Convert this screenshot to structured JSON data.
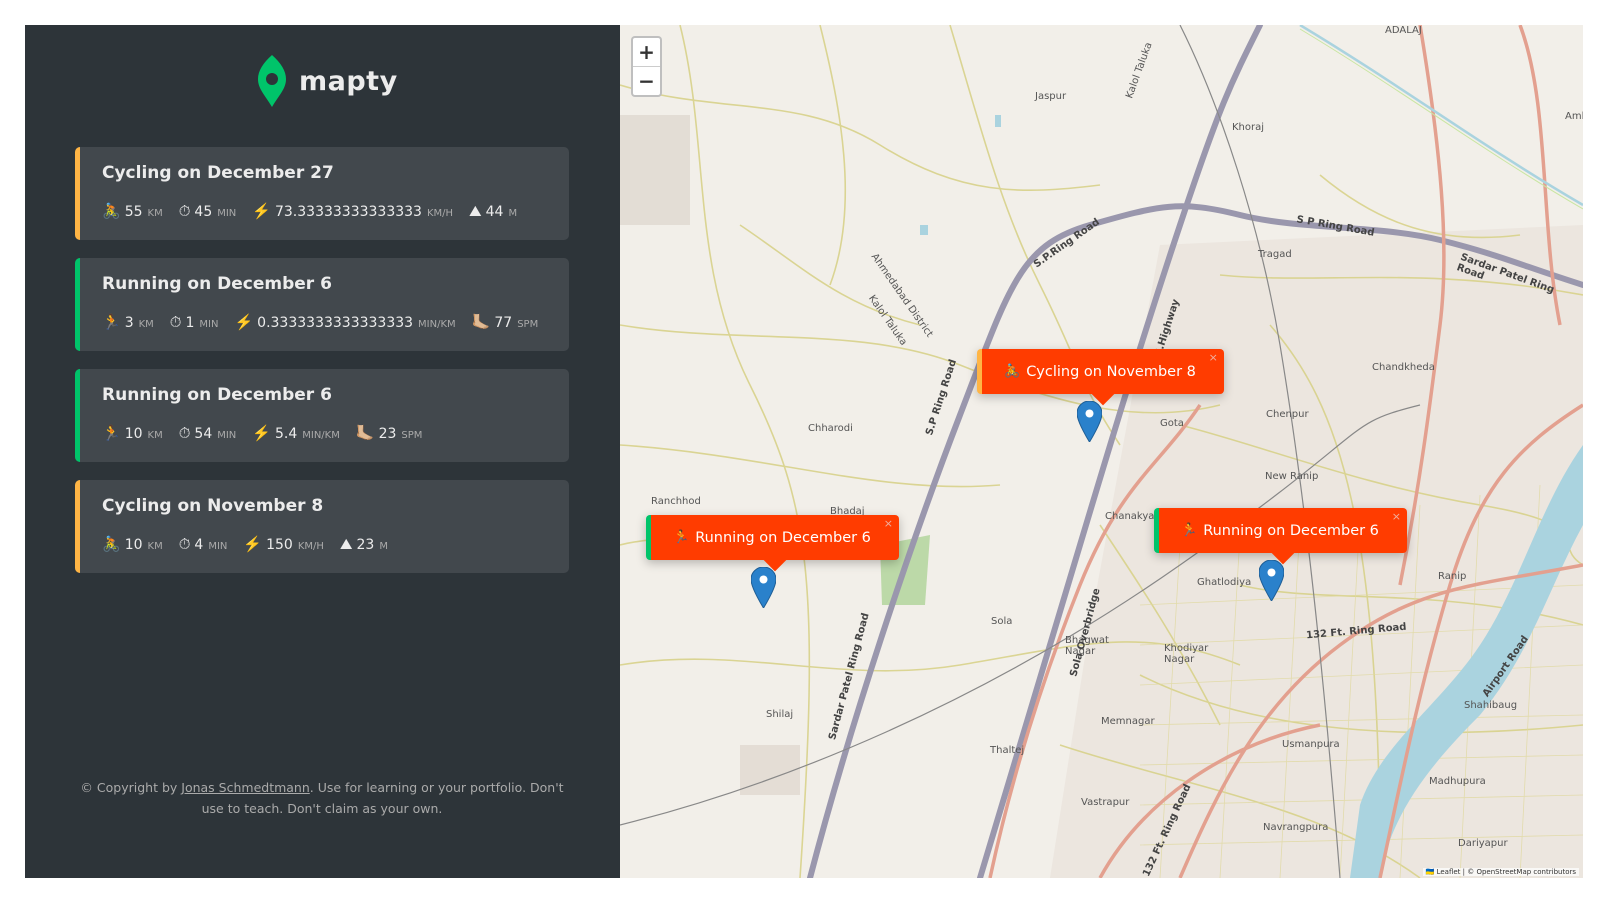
{
  "brand": {
    "name": "mapty"
  },
  "workouts": [
    {
      "type": "cycling",
      "title": "Cycling on December 27",
      "stats": [
        {
          "icon": "🚴",
          "value": "55",
          "unit": "km"
        },
        {
          "icon": "⏱",
          "value": "45",
          "unit": "min"
        },
        {
          "icon": "⚡️",
          "value": "73.33333333333333",
          "unit": "km/h"
        },
        {
          "icon": "⛰",
          "value": "44",
          "unit": "m"
        }
      ]
    },
    {
      "type": "running",
      "title": "Running on December 6",
      "stats": [
        {
          "icon": "🏃",
          "value": "3",
          "unit": "km"
        },
        {
          "icon": "⏱",
          "value": "1",
          "unit": "min"
        },
        {
          "icon": "⚡️",
          "value": "0.3333333333333333",
          "unit": "min/km"
        },
        {
          "icon": "🦶🏼",
          "value": "77",
          "unit": "spm"
        }
      ]
    },
    {
      "type": "running",
      "title": "Running on December 6",
      "stats": [
        {
          "icon": "🏃",
          "value": "10",
          "unit": "km"
        },
        {
          "icon": "⏱",
          "value": "54",
          "unit": "min"
        },
        {
          "icon": "⚡️",
          "value": "5.4",
          "unit": "min/km"
        },
        {
          "icon": "🦶🏼",
          "value": "23",
          "unit": "spm"
        }
      ]
    },
    {
      "type": "cycling",
      "title": "Cycling on November 8",
      "stats": [
        {
          "icon": "🚴",
          "value": "10",
          "unit": "km"
        },
        {
          "icon": "⏱",
          "value": "4",
          "unit": "min"
        },
        {
          "icon": "⚡️",
          "value": "150",
          "unit": "km/h"
        },
        {
          "icon": "⛰",
          "value": "23",
          "unit": "m"
        }
      ]
    }
  ],
  "copyright": {
    "prefix": "© Copyright by ",
    "author": "Jonas Schmedtmann",
    "suffix": ". Use for learning or your portfolio. Don't use to teach. Don't claim as your own."
  },
  "map": {
    "zoom_in": "+",
    "zoom_out": "−",
    "popups": [
      {
        "type": "cycling",
        "icon": "🚴",
        "label": "Cycling on November 8",
        "close": "×"
      },
      {
        "type": "running",
        "icon": "🏃",
        "label": "Running on December 6",
        "close": "×"
      },
      {
        "type": "running",
        "icon": "🏃",
        "label": "Running on December 6",
        "close": "×"
      }
    ],
    "place_labels": [
      "ADALAJ",
      "Jaspur",
      "Kalol Taluka",
      "Khoraj",
      "Tragad",
      "Chandkheda",
      "Chenpur",
      "Gota",
      "Chharodi",
      "Ranchhod",
      "Bhadaj",
      "New Ranip",
      "Chanakyapuri",
      "Ghatlodiya",
      "Ranip",
      "Sola",
      "Bhagwat Nagar",
      "Khodiyar Nagar",
      "Shilaj",
      "Memnagar",
      "Thaltej",
      "Usmanpura",
      "Shahibaug",
      "Madhupura",
      "Vastrapur",
      "Navrangpura",
      "Dariyapur",
      "Ahmedabad District",
      "Kalol Taluka",
      "Aml"
    ],
    "road_labels": [
      "S P Ring Road",
      "S.P.Ring Road",
      "Sardar Patel Ring Road",
      "S.P Ring Road",
      "S.G.Highway",
      "Sardar Patel Ring Road",
      "Sola Overbridge",
      "132 Ft. Ring Road",
      "Airport Road",
      "132 Ft. Ring Road"
    ],
    "attribution": "🇺🇦 Leaflet | © OpenStreetMap contributors"
  }
}
